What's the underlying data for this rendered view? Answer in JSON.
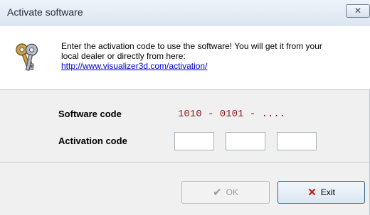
{
  "window": {
    "title": "Activate software",
    "close_glyph": "✕"
  },
  "header": {
    "icon": "keys-icon",
    "line1": "Enter the activation code to use the software! You will get it from your",
    "line2": "local dealer or directly from here:",
    "link": "http://www.visualizer3d.com/activation/"
  },
  "form": {
    "software_code_label": "Software code",
    "software_code_value": "1010 - 0101 - ....",
    "activation_code_label": "Activation code",
    "activation_fields": [
      "",
      "",
      ""
    ]
  },
  "buttons": {
    "ok": {
      "label": "OK",
      "glyph": "✔",
      "enabled": false
    },
    "exit": {
      "label": "Exit",
      "glyph": "✕",
      "glyph_color": "#d01010"
    }
  },
  "colors": {
    "code_value": "#8a1c1c",
    "link": "#0000cc"
  }
}
